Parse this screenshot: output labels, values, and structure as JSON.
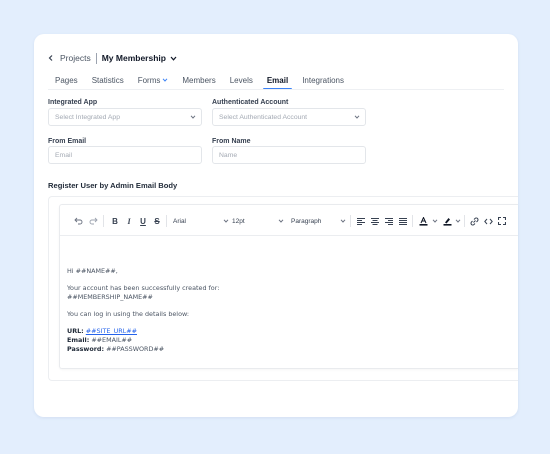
{
  "breadcrumb": {
    "back": "Projects",
    "current": "My Membership"
  },
  "tabs": [
    {
      "label": "Pages"
    },
    {
      "label": "Statistics"
    },
    {
      "label": "Forms"
    },
    {
      "label": "Members"
    },
    {
      "label": "Levels"
    },
    {
      "label": "Email"
    },
    {
      "label": "Integrations"
    }
  ],
  "active_tab": "Email",
  "form": {
    "integrated_app_label": "Integrated App",
    "integrated_app_placeholder": "Select Integrated App",
    "auth_account_label": "Authenticated Account",
    "auth_account_placeholder": "Select Authenticated Account",
    "from_email_label": "From Email",
    "from_email_placeholder": "Email",
    "from_name_label": "From Name",
    "from_name_placeholder": "Name"
  },
  "section_title": "Register User by Admin Email Body",
  "toolbar": {
    "font": "Arial",
    "size": "12pt",
    "block": "Paragraph",
    "bold": "B",
    "italic": "I",
    "underline": "U",
    "strike": "S"
  },
  "body": {
    "greeting": "Hi ##NAME##,",
    "line1": "Your account has been successfully created for:",
    "line2": "##MEMBERSHIP_NAME##",
    "line3": "You can log in using the details below:",
    "url_label": "URL:",
    "url_value": "##SITE_URL##",
    "email_label": "Email:",
    "email_value": "##EMAIL##",
    "password_label": "Password:",
    "password_value": "##PASSWORD##"
  },
  "colors": {
    "accent": "#3b82f6",
    "link": "#2563eb",
    "background": "#e3eefd"
  }
}
